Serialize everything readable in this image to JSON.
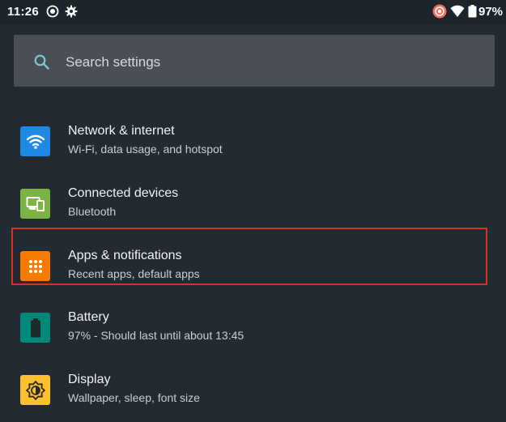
{
  "status_bar": {
    "time": "11:26",
    "battery_text": "97%",
    "left_icons": [
      "screen-record-icon",
      "settings-gear-icon"
    ],
    "right_icons": [
      "recording-indicator-icon",
      "wifi-icon",
      "battery-icon"
    ],
    "battery_level": 0.97,
    "recording_color": "#ee6e5a"
  },
  "search": {
    "placeholder": "Search settings",
    "icon": "search-icon",
    "icon_color": "#7fcad0"
  },
  "settings": [
    {
      "key": "network",
      "title": "Network & internet",
      "subtitle": "Wi-Fi, data usage, and hotspot",
      "icon": "wifi-icon",
      "icon_bg": "#1e88e5"
    },
    {
      "key": "devices",
      "title": "Connected devices",
      "subtitle": "Bluetooth",
      "icon": "devices-icon",
      "icon_bg": "#7cb342"
    },
    {
      "key": "apps",
      "title": "Apps & notifications",
      "subtitle": "Recent apps, default apps",
      "icon": "apps-grid-icon",
      "icon_bg": "#f57c00"
    },
    {
      "key": "battery",
      "title": "Battery",
      "subtitle": "97% - Should last until about 13:45",
      "icon": "battery-icon",
      "icon_bg": "#00897b"
    },
    {
      "key": "display",
      "title": "Display",
      "subtitle": "Wallpaper, sleep, font size",
      "icon": "brightness-icon",
      "icon_bg": "#fbc02d"
    }
  ],
  "highlight": {
    "target": "apps",
    "color": "#d0332b"
  }
}
